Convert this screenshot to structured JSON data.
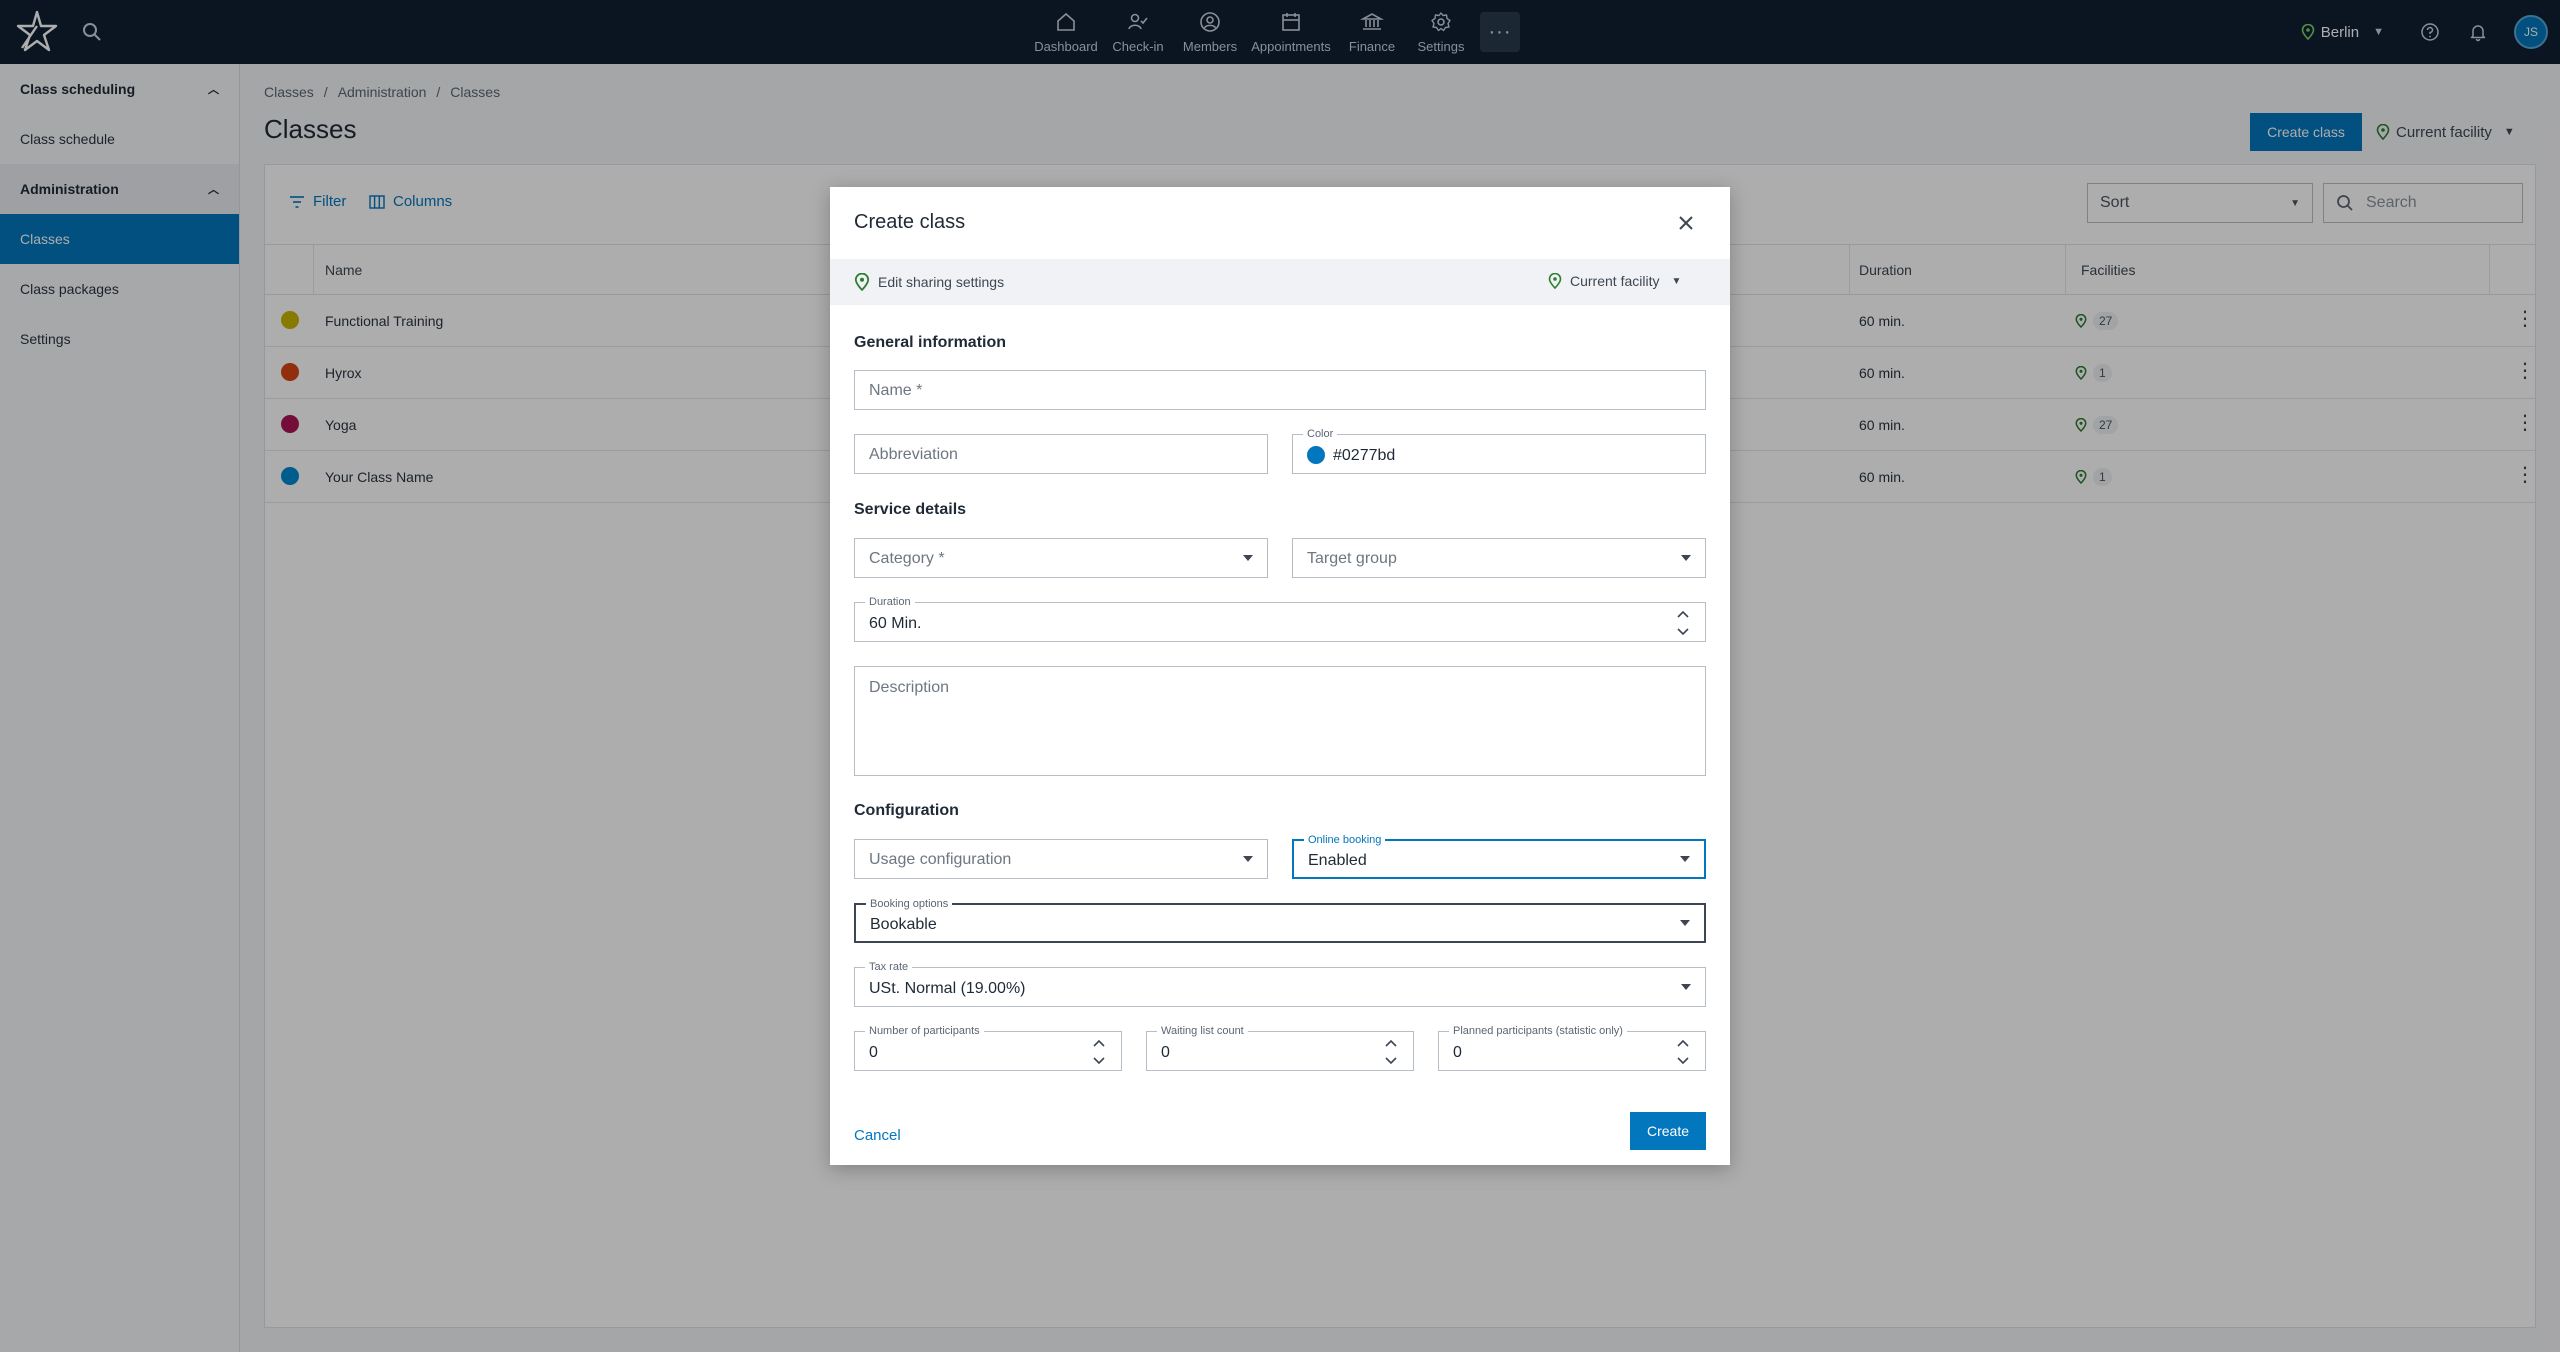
{
  "topnav": {
    "items": [
      {
        "label": "Dashboard",
        "icon": "home-icon"
      },
      {
        "label": "Check-in",
        "icon": "check-in-icon"
      },
      {
        "label": "Members",
        "icon": "members-icon"
      },
      {
        "label": "Appointments",
        "icon": "calendar-icon"
      },
      {
        "label": "Finance",
        "icon": "bank-icon"
      },
      {
        "label": "Settings",
        "icon": "gear-icon"
      }
    ],
    "more_label": "···",
    "location": "Berlin",
    "avatar_initials": "JS"
  },
  "sidebar": {
    "sections": [
      {
        "title": "Class scheduling",
        "items": [
          "Class schedule"
        ]
      },
      {
        "title": "Administration",
        "items": [
          "Classes",
          "Class packages",
          "Settings"
        ]
      }
    ],
    "active_item": "Classes"
  },
  "main": {
    "breadcrumb": [
      "Classes",
      "Administration",
      "Classes"
    ],
    "title": "Classes",
    "create_button": "Create class",
    "facility_button": "Current facility",
    "toolbar": {
      "filter": "Filter",
      "columns": "Columns",
      "sort_placeholder": "Sort",
      "search_placeholder": "Search"
    },
    "table": {
      "headers": {
        "name": "Name",
        "duration": "Duration",
        "facilities": "Facilities"
      },
      "rows": [
        {
          "color": "#c8b400",
          "name": "Functional Training",
          "duration": "60 min.",
          "facilities": "27"
        },
        {
          "color": "#d84315",
          "name": "Hyrox",
          "duration": "60 min.",
          "facilities": "1"
        },
        {
          "color": "#ad1457",
          "name": "Yoga",
          "duration": "60 min.",
          "facilities": "27"
        },
        {
          "color": "#0288d1",
          "name": "Your Class Name",
          "duration": "60 min.",
          "facilities": "1"
        }
      ]
    }
  },
  "modal": {
    "title": "Create class",
    "share_label": "Edit sharing settings",
    "facility_label": "Current facility",
    "general_title": "General information",
    "name_placeholder": "Name *",
    "abbreviation_placeholder": "Abbreviation",
    "color_label": "Color",
    "color_value": "#0277bd",
    "service_title": "Service details",
    "category_placeholder": "Category *",
    "target_group_placeholder": "Target group",
    "duration_label": "Duration",
    "duration_value": "60 Min.",
    "description_placeholder": "Description",
    "config_title": "Configuration",
    "usage_placeholder": "Usage configuration",
    "online_booking_label": "Online booking",
    "online_booking_value": "Enabled",
    "booking_options_label": "Booking options",
    "booking_options_value": "Bookable",
    "tax_rate_label": "Tax rate",
    "tax_rate_value": "USt. Normal (19.00%)",
    "participants_label": "Number of participants",
    "participants_value": "0",
    "waiting_label": "Waiting list count",
    "waiting_value": "0",
    "planned_label": "Planned participants (statistic only)",
    "planned_value": "0",
    "cancel_label": "Cancel",
    "create_label": "Create"
  },
  "colors": {
    "topbar": "#101f31",
    "accent": "#0277bd"
  }
}
